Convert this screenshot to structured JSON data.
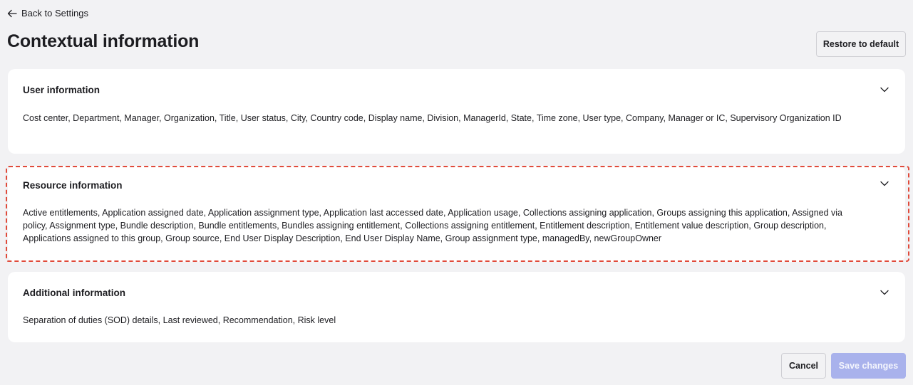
{
  "header": {
    "back_label": "Back to Settings",
    "title": "Contextual information",
    "restore_label": "Restore to default"
  },
  "sections": [
    {
      "title": "User information",
      "description": "Cost center, Department, Manager, Organization, Title, User status, City, Country code, Display name, Division, ManagerId, State, Time zone, User type, Company, Manager or IC, Supervisory Organization ID",
      "icon": "chevron-down-icon"
    },
    {
      "title": "Resource information",
      "description": "Active entitlements, Application assigned date, Application assignment type, Application last accessed date, Application usage, Collections assigning application, Groups assigning this application, Assigned via policy, Assignment type, Bundle description, Bundle entitlements, Bundles assigning entitlement, Collections assigning entitlement, Entitlement description, Entitlement value description, Group description, Applications assigned to this group, Group source, End User Display Description, End User Display Name, Group assignment type, managedBy, newGroupOwner",
      "icon": "chevron-down-icon",
      "highlighted": true
    },
    {
      "title": "Additional information",
      "description": "Separation of duties (SOD) details, Last reviewed, Recommendation, Risk level",
      "icon": "chevron-down-icon"
    }
  ],
  "footer": {
    "cancel_label": "Cancel",
    "save_label": "Save changes",
    "save_disabled": true
  },
  "colors": {
    "background": "#f2f2f4",
    "card": "#ffffff",
    "highlight_dash": "#e04a3a",
    "save_disabled_bg": "#a9b2ec"
  }
}
